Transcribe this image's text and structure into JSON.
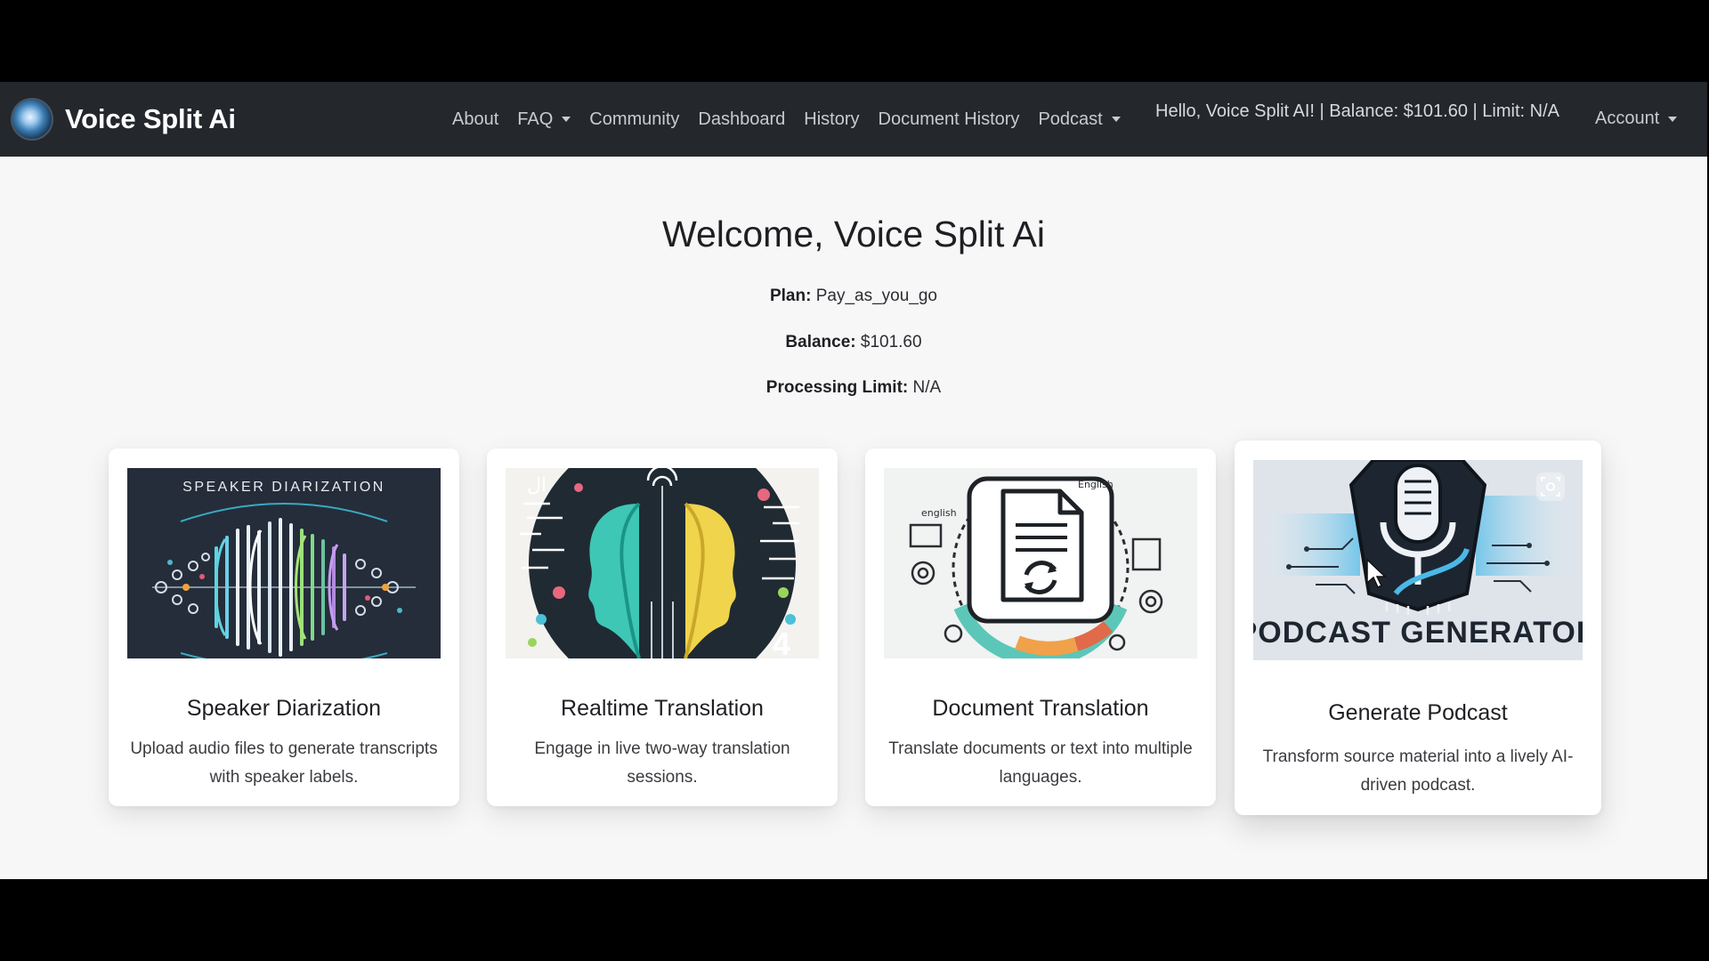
{
  "navbar": {
    "brand": "Voice Split Ai",
    "links": [
      {
        "label": "About"
      },
      {
        "label": "FAQ",
        "dropdown": true
      },
      {
        "label": "Community"
      },
      {
        "label": "Dashboard"
      },
      {
        "label": "History"
      },
      {
        "label": "Document History"
      },
      {
        "label": "Podcast",
        "dropdown": true
      }
    ],
    "greeting": "Hello, Voice Split AI! | Balance: $101.60 | Limit: N/A",
    "account": "Account"
  },
  "welcome": {
    "title": "Welcome, Voice Split Ai",
    "plan_label": "Plan:",
    "plan_value": "Pay_as_you_go",
    "balance_label": "Balance:",
    "balance_value": "$101.60",
    "limit_label": "Processing Limit:",
    "limit_value": "N/A"
  },
  "cards": [
    {
      "title": "Speaker Diarization",
      "description": "Upload audio files to generate transcripts with speaker labels.",
      "image_text": "SPEAKER DIARIZATION",
      "icon": "speaker-diarization-illustration"
    },
    {
      "title": "Realtime Translation",
      "description": "Engage in live two-way translation sessions.",
      "icon": "two-faces-translation-illustration"
    },
    {
      "title": "Document Translation",
      "description": "Translate documents or text into multiple languages.",
      "icon": "document-sync-illustration"
    },
    {
      "title": "Generate Podcast",
      "description": "Transform source material into a lively AI-driven podcast.",
      "image_text": "PODCAST GENERATOR",
      "icon": "microphone-illustration"
    }
  ],
  "colors": {
    "navbar_bg": "#24272c",
    "page_bg": "#f7f7f8",
    "card_bg": "#ffffff",
    "nav_text": "#c9cbcf"
  }
}
